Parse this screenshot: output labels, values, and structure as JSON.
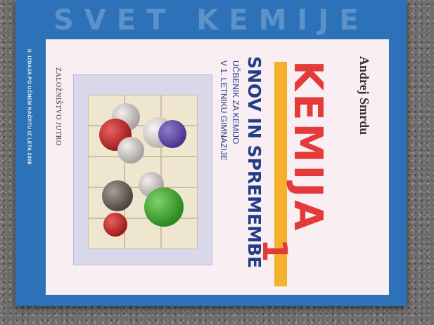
{
  "cover": {
    "series_title": "SVET KEMIJE",
    "edition_note": "II. IZDAJA PO UČNEM NAČRTU IZ LETA 2008",
    "author": "Andrej Smrdu",
    "title": "KEMIJA",
    "subtitle": "SNOV IN SPREMEMBE",
    "volume": "1",
    "description_line1": "UČBENIK ZA KEMIJO",
    "description_line2": "V 1. LETNIKU GIMNAZIJE",
    "publisher": "ZALOŽNIŠTVO JUTRO"
  },
  "colors": {
    "cover_blue": "#2d72b8",
    "title_red": "#e43a3a",
    "subtitle_navy": "#243d8a",
    "accent_orange": "#f5b12d"
  }
}
